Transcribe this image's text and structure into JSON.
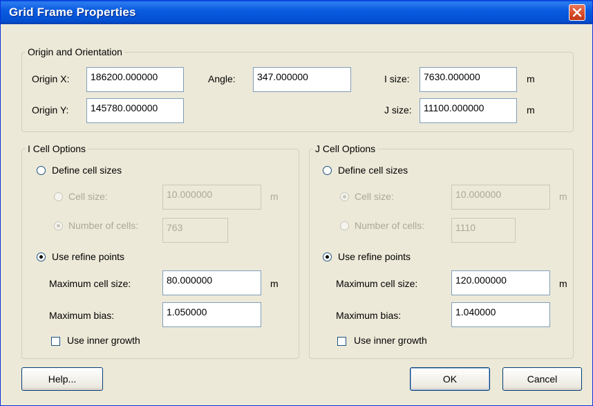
{
  "window": {
    "title": "Grid Frame Properties"
  },
  "origin_group": {
    "legend": "Origin and Orientation",
    "origin_x_label": "Origin X:",
    "origin_x_value": "186200.000000",
    "origin_y_label": "Origin Y:",
    "origin_y_value": "145780.000000",
    "angle_label": "Angle:",
    "angle_value": "347.000000",
    "i_size_label": "I size:",
    "i_size_value": "7630.000000",
    "j_size_label": "J size:",
    "j_size_value": "11100.000000",
    "unit": "m"
  },
  "i_cell": {
    "legend": "I Cell Options",
    "define_label": "Define cell sizes",
    "cell_size_label": "Cell size:",
    "cell_size_value": "10.000000",
    "num_cells_label": "Number of cells:",
    "num_cells_value": "763",
    "refine_label": "Use refine points",
    "max_cell_label": "Maximum cell size:",
    "max_cell_value": "80.000000",
    "max_bias_label": "Maximum bias:",
    "max_bias_value": "1.050000",
    "inner_growth_label": "Use inner growth",
    "unit": "m"
  },
  "j_cell": {
    "legend": "J Cell Options",
    "define_label": "Define cell sizes",
    "cell_size_label": "Cell size:",
    "cell_size_value": "10.000000",
    "num_cells_label": "Number of cells:",
    "num_cells_value": "1110",
    "refine_label": "Use refine points",
    "max_cell_label": "Maximum cell size:",
    "max_cell_value": "120.000000",
    "max_bias_label": "Maximum bias:",
    "max_bias_value": "1.040000",
    "inner_growth_label": "Use inner growth",
    "unit": "m"
  },
  "buttons": {
    "help": "Help...",
    "ok": "OK",
    "cancel": "Cancel"
  },
  "colors": {
    "titlebar": "#0a5ce0",
    "dialog_bg": "#ece9d8",
    "close": "#d94e2b"
  }
}
